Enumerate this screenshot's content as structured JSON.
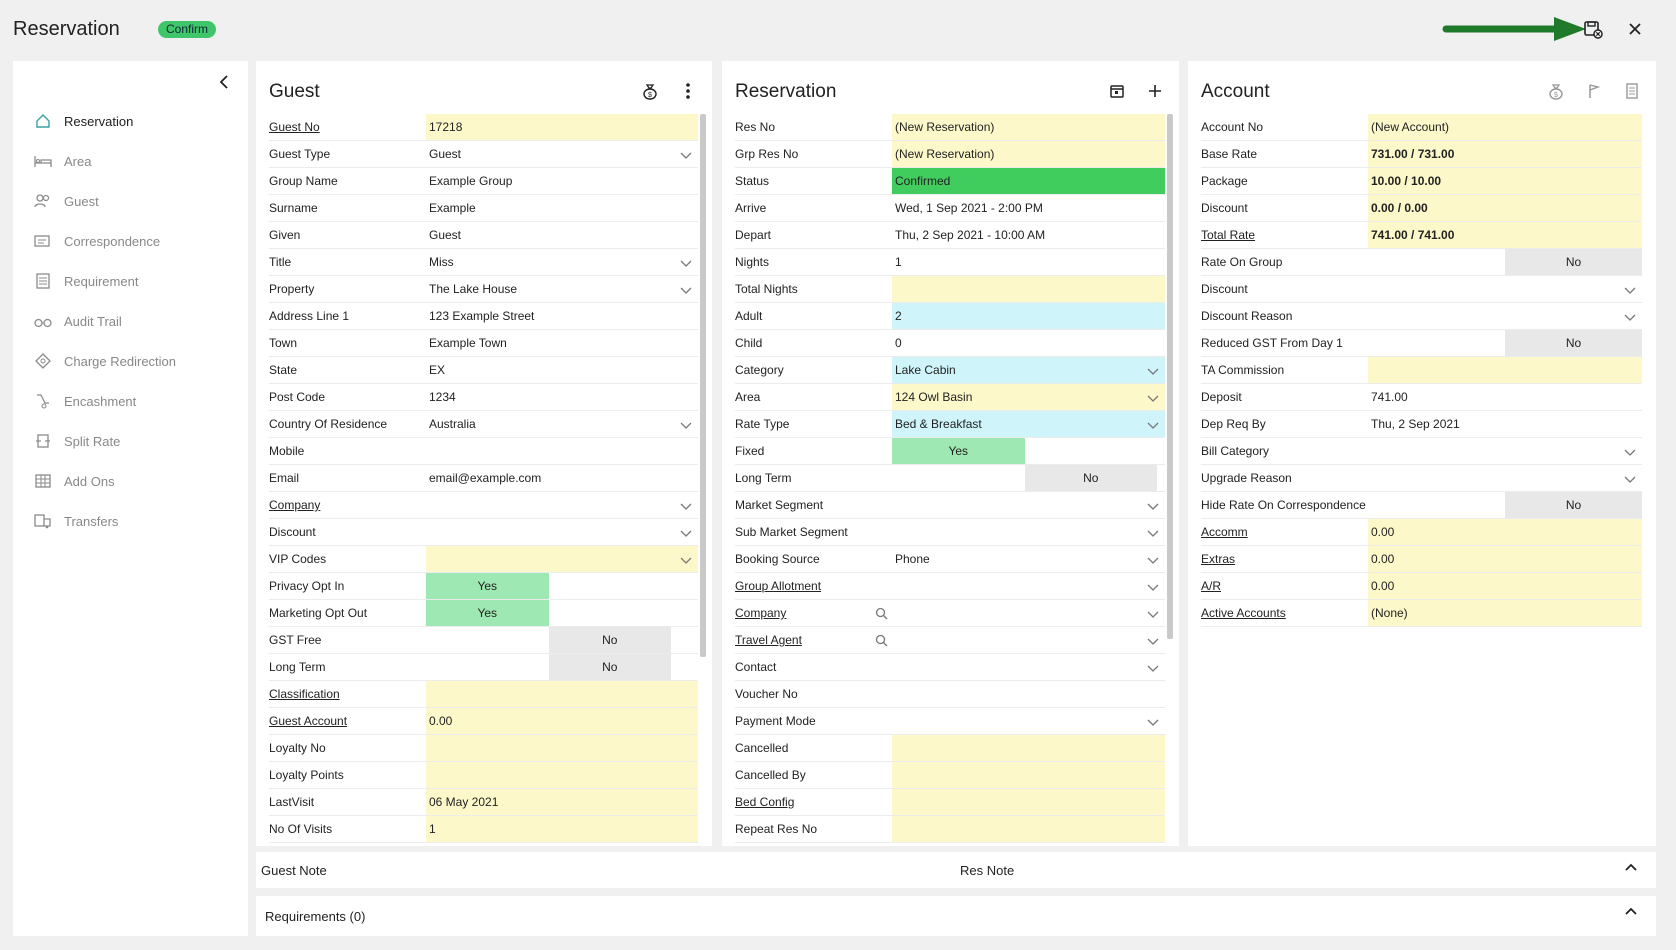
{
  "app": {
    "title": "Reservation",
    "badge": "Confirm"
  },
  "top_icons": [
    "lock-icon",
    "save-reservation-icon",
    "close-icon"
  ],
  "sidebar": {
    "items": [
      {
        "label": "Reservation",
        "icon": "home-icon",
        "active": true
      },
      {
        "label": "Area",
        "icon": "bed-icon",
        "active": false
      },
      {
        "label": "Guest",
        "icon": "guests-icon",
        "active": false
      },
      {
        "label": "Correspondence",
        "icon": "correspondence-icon",
        "active": false
      },
      {
        "label": "Requirement",
        "icon": "list-icon",
        "active": false
      },
      {
        "label": "Audit Trail",
        "icon": "glasses-icon",
        "active": false
      },
      {
        "label": "Charge Redirection",
        "icon": "diamond-icon",
        "active": false
      },
      {
        "label": "Encashment",
        "icon": "encash-icon",
        "active": false
      },
      {
        "label": "Split Rate",
        "icon": "split-icon",
        "active": false
      },
      {
        "label": "Add Ons",
        "icon": "grid-icon",
        "active": false
      },
      {
        "label": "Transfers",
        "icon": "transfer-icon",
        "active": false
      }
    ]
  },
  "guest": {
    "title": "Guest",
    "rows": [
      {
        "label": "Guest No",
        "value": "17218",
        "link": true,
        "style": "yellow"
      },
      {
        "label": "Guest Type",
        "value": "Guest",
        "chevron": true
      },
      {
        "label": "Group Name",
        "value": "Example  Group"
      },
      {
        "label": "Surname",
        "value": "Example"
      },
      {
        "label": "Given",
        "value": "Guest"
      },
      {
        "label": "Title",
        "value": "Miss",
        "chevron": true
      },
      {
        "label": "Property",
        "value": "The Lake House",
        "chevron": true
      },
      {
        "label": "Address Line 1",
        "value": "123 Example Street"
      },
      {
        "label": "Town",
        "value": "Example Town"
      },
      {
        "label": "State",
        "value": "EX"
      },
      {
        "label": "Post Code",
        "value": "1234"
      },
      {
        "label": "Country Of Residence",
        "value": "Australia",
        "chevron": true
      },
      {
        "label": "Mobile",
        "value": ""
      },
      {
        "label": "Email",
        "value": "email@example.com"
      },
      {
        "label": "Company",
        "value": "",
        "link": true,
        "chevron": true
      },
      {
        "label": "Discount",
        "value": "",
        "chevron": true
      },
      {
        "label": "VIP Codes",
        "value": "",
        "style": "yellow",
        "chevron": true
      },
      {
        "label": "Privacy Opt In",
        "toggle": "yes",
        "value": "Yes"
      },
      {
        "label": "Marketing Opt Out",
        "toggle": "yes",
        "value": "Yes"
      },
      {
        "label": "GST Free",
        "toggle": "no",
        "value": "No"
      },
      {
        "label": "Long Term",
        "toggle": "no",
        "value": "No"
      },
      {
        "label": "Classification",
        "value": "",
        "link": true,
        "style": "yellow"
      },
      {
        "label": "Guest Account",
        "value": "0.00",
        "link": true,
        "style": "yellow"
      },
      {
        "label": "Loyalty No",
        "value": "",
        "style": "yellow"
      },
      {
        "label": "Loyalty Points",
        "value": "",
        "style": "yellow"
      },
      {
        "label": "LastVisit",
        "value": "06 May 2021",
        "style": "yellow"
      },
      {
        "label": "No Of Visits",
        "value": "1",
        "style": "yellow"
      }
    ]
  },
  "reservation": {
    "title": "Reservation",
    "rows": [
      {
        "label": "Res No",
        "value": "(New Reservation)",
        "style": "yellow"
      },
      {
        "label": "Grp Res No",
        "value": "(New Reservation)",
        "style": "yellow"
      },
      {
        "label": "Status",
        "value": "Confirmed",
        "style": "green"
      },
      {
        "label": "Arrive",
        "value": "Wed, 1 Sep 2021 - 2:00 PM"
      },
      {
        "label": "Depart",
        "value": "Thu, 2 Sep 2021 - 10:00 AM"
      },
      {
        "label": "Nights",
        "value": "1"
      },
      {
        "label": "Total Nights",
        "value": "",
        "style": "yellow"
      },
      {
        "label": "Adult",
        "value": "2",
        "style": "cyan"
      },
      {
        "label": "Child",
        "value": "0"
      },
      {
        "label": "Category",
        "value": "Lake Cabin",
        "style": "cyan",
        "chevron": true
      },
      {
        "label": "Area",
        "value": "124 Owl Basin",
        "style": "yellow",
        "chevron": true
      },
      {
        "label": "Rate Type",
        "value": "Bed & Breakfast",
        "style": "cyan",
        "chevron": true
      },
      {
        "label": "Fixed",
        "toggle": "yes",
        "value": "Yes"
      },
      {
        "label": "Long Term",
        "toggle": "no",
        "value": "No"
      },
      {
        "label": "Market Segment",
        "value": "",
        "chevron": true
      },
      {
        "label": "Sub Market Segment",
        "value": "",
        "chevron": true
      },
      {
        "label": "Booking Source",
        "value": "Phone",
        "chevron": true
      },
      {
        "label": "Group Allotment",
        "value": "",
        "link": true,
        "chevron": true
      },
      {
        "label": "Company",
        "value": "",
        "link": true,
        "chevron": true,
        "search": true
      },
      {
        "label": "Travel Agent",
        "value": "",
        "link": true,
        "chevron": true,
        "search": true
      },
      {
        "label": "Contact",
        "value": "",
        "chevron": true
      },
      {
        "label": "Voucher No",
        "value": ""
      },
      {
        "label": "Payment Mode",
        "value": "",
        "chevron": true
      },
      {
        "label": "Cancelled",
        "value": "",
        "style": "yellow"
      },
      {
        "label": "Cancelled By",
        "value": "",
        "style": "yellow"
      },
      {
        "label": "Bed Config",
        "value": "",
        "link": true,
        "style": "yellow"
      },
      {
        "label": "Repeat Res No",
        "value": "",
        "style": "yellow"
      }
    ]
  },
  "account": {
    "title": "Account",
    "rows": [
      {
        "label": "Account No",
        "value": "(New Account)",
        "style": "yellow"
      },
      {
        "label": "Base Rate",
        "value": "731.00 / 731.00",
        "style": "yellow",
        "bold": true
      },
      {
        "label": "Package",
        "value": "10.00 / 10.00",
        "style": "yellow",
        "bold": true
      },
      {
        "label": "Discount",
        "value": "0.00 / 0.00",
        "style": "yellow",
        "bold": true
      },
      {
        "label": "Total Rate",
        "value": "741.00 / 741.00",
        "link": true,
        "style": "yellow",
        "bold": true
      },
      {
        "label": "Rate On Group",
        "toggle": "no",
        "value": "No"
      },
      {
        "label": "Discount",
        "value": "",
        "chevron": true
      },
      {
        "label": "Discount Reason",
        "value": "",
        "chevron": true
      },
      {
        "label": "Reduced GST From Day 1",
        "toggle": "no",
        "value": "No"
      },
      {
        "label": "TA Commission",
        "value": "",
        "style": "yellow"
      },
      {
        "label": "Deposit",
        "value": "741.00"
      },
      {
        "label": "Dep Req By",
        "value": "Thu, 2 Sep 2021"
      },
      {
        "label": "Bill Category",
        "value": "",
        "chevron": true
      },
      {
        "label": "Upgrade Reason",
        "value": "",
        "chevron": true
      },
      {
        "label": "Hide Rate On Correspondence",
        "toggle": "no",
        "value": "No"
      },
      {
        "label": "Accomm",
        "value": "0.00",
        "link": true,
        "style": "yellow"
      },
      {
        "label": "Extras",
        "value": "0.00",
        "link": true,
        "style": "yellow"
      },
      {
        "label": "A/R",
        "value": "0.00",
        "link": true,
        "style": "yellow"
      },
      {
        "label": "Active Accounts",
        "value": "(None)",
        "link": true,
        "style": "yellow"
      }
    ]
  },
  "notes": {
    "guest_note": "Guest Note",
    "res_note": "Res Note"
  },
  "requirements": {
    "label": "Requirements (0)"
  }
}
